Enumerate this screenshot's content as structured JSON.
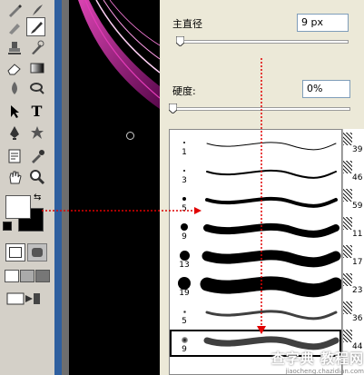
{
  "toolbox": {
    "tools": [
      {
        "name": "pen-pencil-tool-icon"
      },
      {
        "name": "brush-tool-icon",
        "active": true
      },
      {
        "name": "clone-stamp-tool-icon"
      },
      {
        "name": "history-brush-tool-icon"
      },
      {
        "name": "eraser-tool-icon"
      },
      {
        "name": "gradient-tool-icon"
      },
      {
        "name": "blur-tool-icon"
      },
      {
        "name": "dodge-tool-icon"
      },
      {
        "name": "path-selection-tool-icon"
      },
      {
        "name": "type-tool-icon",
        "glyph": "T"
      },
      {
        "name": "pen-tool-icon"
      },
      {
        "name": "custom-shape-tool-icon"
      },
      {
        "name": "notes-tool-icon"
      },
      {
        "name": "eyedropper-tool-icon"
      },
      {
        "name": "hand-tool-icon"
      },
      {
        "name": "zoom-tool-icon"
      }
    ],
    "foreground_color": "#ffffff",
    "background_color": "#000000"
  },
  "brush_panel": {
    "diameter_label": "主直径",
    "diameter_value": "9 px",
    "hardness_label": "硬度:",
    "hardness_value": "0%"
  },
  "brush_presets": [
    {
      "size": "1",
      "stroke": 1
    },
    {
      "size": "3",
      "stroke": 2
    },
    {
      "size": "5",
      "stroke": 4
    },
    {
      "size": "9",
      "stroke": 8
    },
    {
      "size": "13",
      "stroke": 11
    },
    {
      "size": "19",
      "stroke": 15
    },
    {
      "size": "5",
      "stroke": 3
    },
    {
      "size": "9",
      "stroke": 7,
      "selected": true
    }
  ],
  "right_column_numbers": [
    "39",
    "46",
    "59",
    "11",
    "17",
    "23",
    "36",
    "44"
  ],
  "watermark": {
    "main": "查字典 教程网",
    "sub": "jiaocheng.chazidian.com"
  },
  "colors": {
    "panel_bg": "#ece9d8",
    "toolbox_bg": "#d4d0c8",
    "arrow": "#e00000",
    "frame_blue": "#2f5f9f"
  }
}
